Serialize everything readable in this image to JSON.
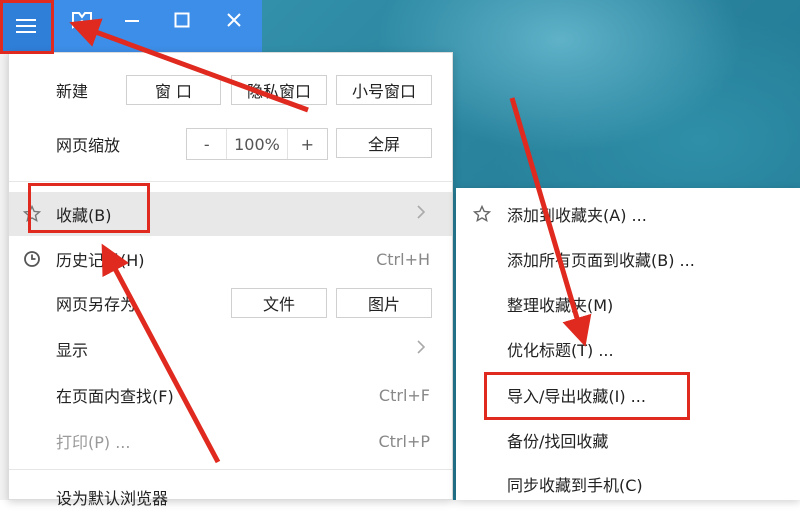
{
  "window": {
    "menu_icon": "hamburger-icon",
    "extra_icon": "bookmark-ribbon-icon",
    "minimize_icon": "minimize-icon",
    "maximize_icon": "maximize-icon",
    "close_icon": "close-icon"
  },
  "main_menu": {
    "new_label": "新建",
    "new_window": "窗 口",
    "new_private": "隐私窗口",
    "new_small": "小号窗口",
    "zoom_label": "网页缩放",
    "zoom_minus": "-",
    "zoom_value": "100%",
    "zoom_plus": "+",
    "fullscreen": "全屏",
    "favorites": "收藏(B)",
    "history": "历史记录(H)",
    "history_shortcut": "Ctrl+H",
    "save_as": "网页另存为",
    "save_file": "文件",
    "save_image": "图片",
    "display": "显示",
    "find": "在页面内查找(F)",
    "find_shortcut": "Ctrl+F",
    "print": "打印(P) ...",
    "print_shortcut": "Ctrl+P",
    "default_browser": "设为默认浏览器"
  },
  "sub_menu": {
    "add_to_favorites": "添加到收藏夹(A) ...",
    "add_all_pages": "添加所有页面到收藏(B) ...",
    "organize": "整理收藏夹(M)",
    "optimize_titles": "优化标题(T) ...",
    "import_export": "导入/导出收藏(I) ...",
    "backup_restore": "备份/找回收藏",
    "sync_to_phone": "同步收藏到手机(C)"
  },
  "colors": {
    "titlebar": "#3d8ee8",
    "menu_highlight": "#e8e8e8",
    "annotation_red": "#e02a1f"
  }
}
